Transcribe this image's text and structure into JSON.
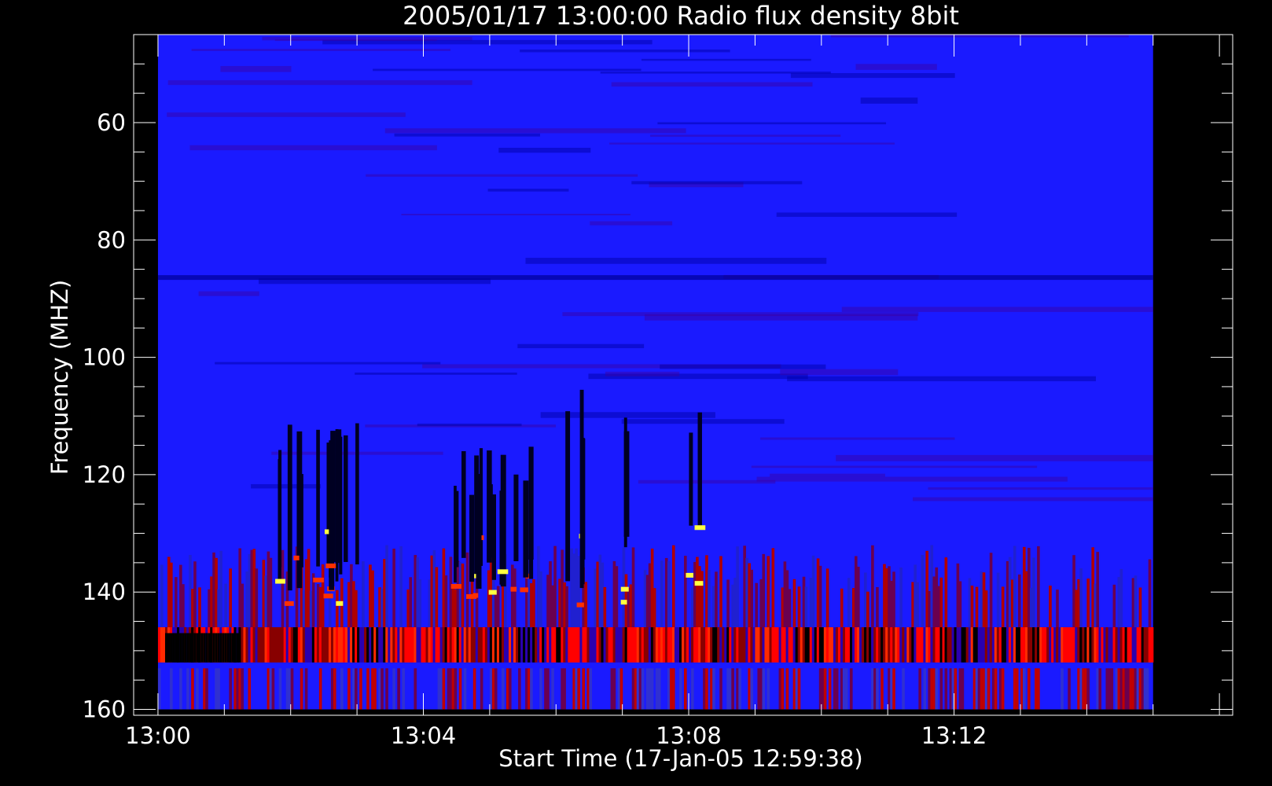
{
  "chart_data": {
    "type": "heatmap",
    "title": "2005/01/17 13:00:00 Radio flux density 8bit",
    "xlabel": "Start Time (17-Jan-05 12:59:38)",
    "ylabel": "Frequency (MHZ)",
    "x_tick_labels": [
      "13:00",
      "13:04",
      "13:08",
      "13:12"
    ],
    "y_tick_labels": [
      "60",
      "80",
      "100",
      "120",
      "140",
      "160"
    ],
    "y_ticks": [
      60,
      80,
      100,
      120,
      140,
      160
    ],
    "ylim": [
      45,
      161
    ],
    "y_inverted": true,
    "x_range_minutes": [
      -0.3667,
      16.2
    ],
    "data_x_range_minutes": [
      0,
      15
    ],
    "data_y_range_mhz": [
      45,
      160
    ],
    "colormap": [
      "#000000",
      "#0000ff",
      "#ff0000",
      "#ffff00"
    ],
    "features": [
      {
        "type": "background",
        "level": "low",
        "color": "#1a1aff",
        "y_range_mhz": [
          45,
          160
        ]
      },
      {
        "type": "burst_band",
        "level": "high",
        "y_range_mhz": [
          146,
          152
        ],
        "description": "strong striped emission band"
      },
      {
        "type": "burst_band",
        "level": "medium",
        "y_range_mhz": [
          132,
          146
        ]
      },
      {
        "type": "burst_band",
        "level": "medium",
        "y_range_mhz": [
          152,
          160
        ]
      },
      {
        "type": "burst",
        "x_minutes": [
          1.8,
          3.0
        ],
        "y_range_mhz": [
          110,
          140
        ]
      },
      {
        "type": "burst",
        "x_minutes": [
          4.4,
          5.6
        ],
        "y_range_mhz": [
          115,
          140
        ]
      },
      {
        "type": "burst",
        "x_minutes": [
          6.1,
          6.4
        ],
        "y_range_mhz": [
          105,
          140
        ]
      },
      {
        "type": "burst",
        "x_minutes": [
          7.0,
          7.1
        ],
        "y_range_mhz": [
          105,
          135
        ]
      },
      {
        "type": "burst",
        "x_minutes": [
          8.0,
          8.2
        ],
        "y_range_mhz": [
          108,
          130
        ]
      }
    ]
  }
}
